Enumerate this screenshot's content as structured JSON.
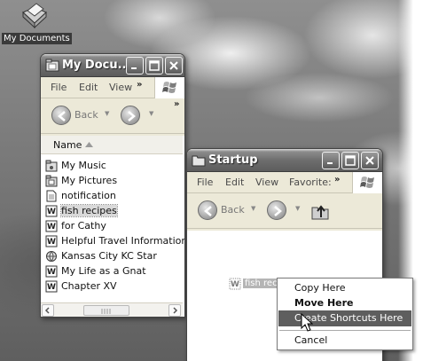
{
  "desktop": {
    "icon_label": "My Documents",
    "icon_name": "folder-documents-icon"
  },
  "my_documents_window": {
    "title": "My Docu...",
    "menu": [
      "File",
      "Edit",
      "View"
    ],
    "toolbar": {
      "back_label": "Back"
    },
    "column_header": "Name",
    "files": [
      {
        "name": "My Music",
        "icon": "folder-music-icon"
      },
      {
        "name": "My Pictures",
        "icon": "folder-pictures-icon"
      },
      {
        "name": "notification",
        "icon": "document-icon"
      },
      {
        "name": "fish recipes",
        "icon": "word-document-icon",
        "selected": true
      },
      {
        "name": "for Cathy",
        "icon": "word-document-icon"
      },
      {
        "name": "Helpful Travel Information",
        "icon": "word-document-icon"
      },
      {
        "name": "Kansas City KC Star",
        "icon": "internet-shortcut-icon"
      },
      {
        "name": "My Life as a Gnat",
        "icon": "word-document-icon"
      },
      {
        "name": "Chapter XV",
        "icon": "word-document-icon"
      }
    ]
  },
  "startup_window": {
    "title": "Startup",
    "menu": [
      "File",
      "Edit",
      "View",
      "Favorite:"
    ],
    "toolbar": {
      "back_label": "Back"
    }
  },
  "drag_item": {
    "label": "fish reci"
  },
  "context_menu": {
    "items": [
      {
        "label": "Copy Here",
        "bold": false,
        "highlighted": false
      },
      {
        "label": "Move Here",
        "bold": true,
        "highlighted": false
      },
      {
        "label": "Create Shortcuts Here",
        "bold": false,
        "highlighted": true
      },
      {
        "label": "Cancel",
        "bold": false,
        "highlighted": false
      }
    ]
  },
  "colors": {
    "selection": "#5e5e5e",
    "window_face": "#ece9d8",
    "titlebar": "#6e6e6e"
  }
}
